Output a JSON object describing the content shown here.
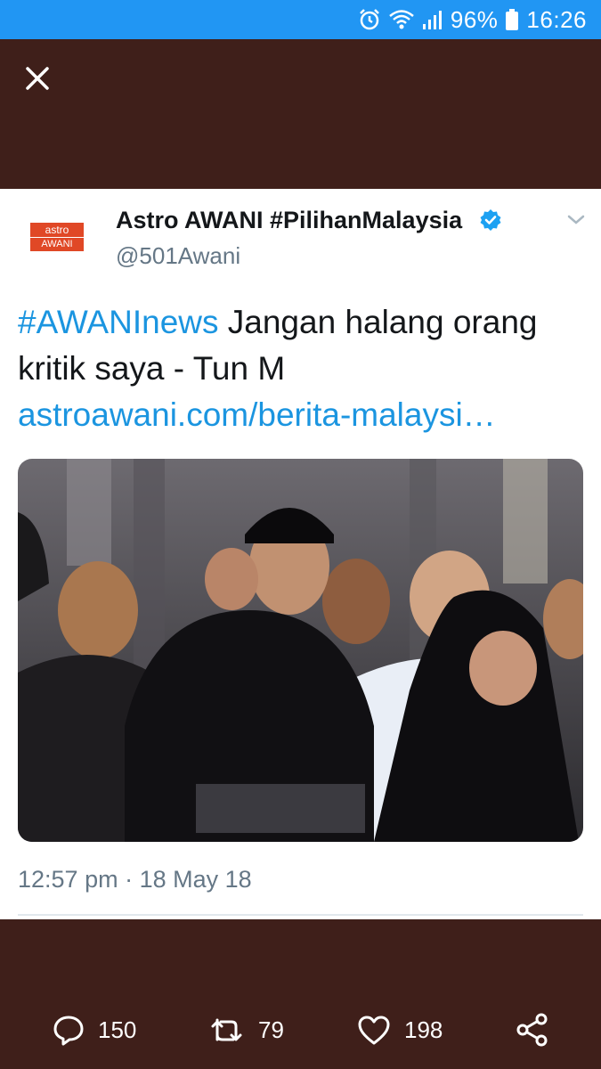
{
  "status_bar": {
    "battery": "96%",
    "time": "16:26",
    "icons": [
      "alarm-icon",
      "wifi-icon",
      "signal-icon",
      "battery-icon"
    ]
  },
  "toolbar": {
    "close_icon": "close-icon"
  },
  "tweet": {
    "avatar": {
      "line1": "astro",
      "line2": "AWANI"
    },
    "display_name": "Astro AWANI #PilihanMalaysia",
    "verified_icon": "verified-badge-icon",
    "handle": "@501Awani",
    "hashtag": "#AWANInews",
    "text": "Jangan halang orang kritik saya - Tun M",
    "link": "astroawani.com/berita-malaysi…",
    "timestamp": "12:57 pm · 18 May 18"
  },
  "actions": {
    "reply": {
      "icon": "reply-icon",
      "count": "150"
    },
    "retweet": {
      "icon": "retweet-icon",
      "count": "79"
    },
    "like": {
      "icon": "heart-icon",
      "count": "198"
    },
    "share": {
      "icon": "share-icon"
    }
  },
  "colors": {
    "status_bar": "#2196f3",
    "background": "#3f1f1a",
    "link": "#1b95e0",
    "verified": "#1da1f2",
    "secondary_text": "#657786"
  }
}
